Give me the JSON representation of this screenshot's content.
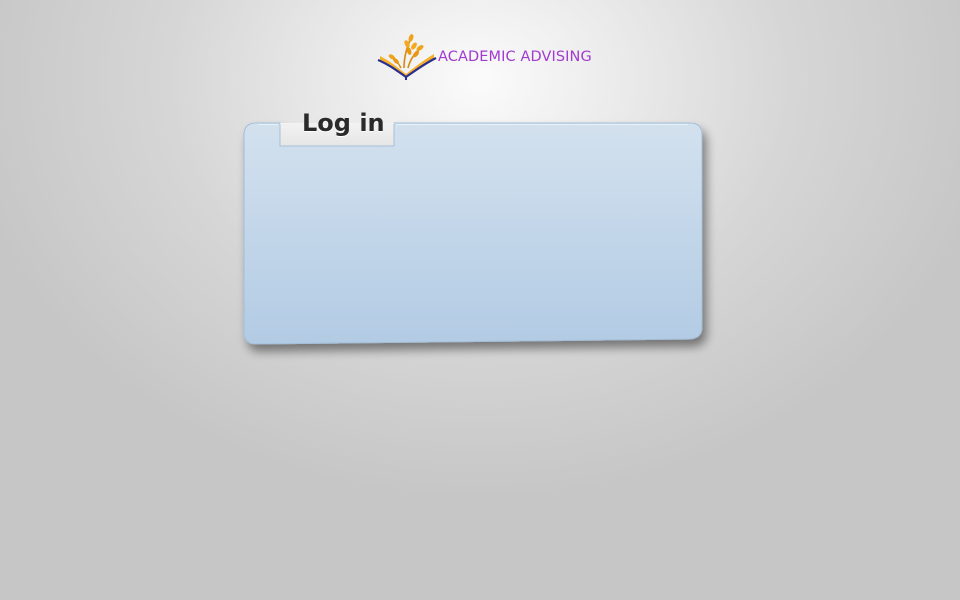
{
  "brand": {
    "logo_icon": "book-wheat-logo-icon",
    "name": "ACADEMIC ADVISING",
    "name_color": "#a23ad0"
  },
  "login_panel": {
    "title": "Log in",
    "fill_top": "#d3e1ee",
    "fill_bottom": "#b2cbe4",
    "border_color": "#a5bfd9"
  }
}
